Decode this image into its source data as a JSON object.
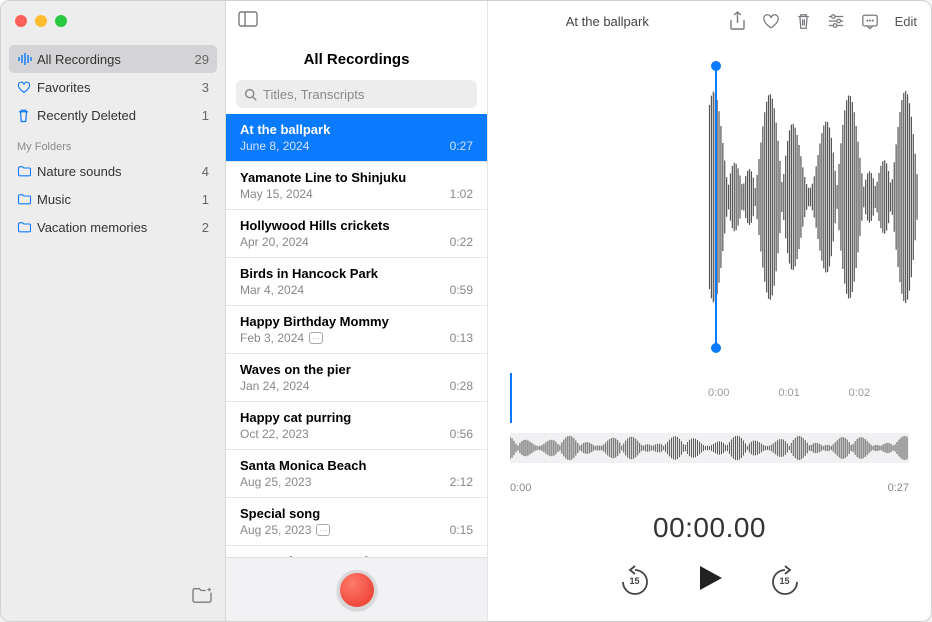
{
  "toolbar": {
    "current_title": "At the ballpark",
    "edit_label": "Edit"
  },
  "sidebar": {
    "smart_items": [
      {
        "label": "All Recordings",
        "count": 29
      },
      {
        "label": "Favorites",
        "count": 3
      },
      {
        "label": "Recently Deleted",
        "count": 1
      }
    ],
    "folders_header": "My Folders",
    "folders": [
      {
        "label": "Nature sounds",
        "count": 4
      },
      {
        "label": "Music",
        "count": 1
      },
      {
        "label": "Vacation memories",
        "count": 2
      }
    ]
  },
  "recordings_column": {
    "title": "All Recordings",
    "search_placeholder": "Titles, Transcripts"
  },
  "recordings": [
    {
      "title": "At the ballpark",
      "date": "June 8, 2024",
      "duration": "0:27",
      "transcript": false
    },
    {
      "title": "Yamanote Line to Shinjuku",
      "date": "May 15, 2024",
      "duration": "1:02",
      "transcript": false
    },
    {
      "title": "Hollywood Hills crickets",
      "date": "Apr 20, 2024",
      "duration": "0:22",
      "transcript": false
    },
    {
      "title": "Birds in Hancock Park",
      "date": "Mar 4, 2024",
      "duration": "0:59",
      "transcript": false
    },
    {
      "title": "Happy Birthday Mommy",
      "date": "Feb 3, 2024",
      "duration": "0:13",
      "transcript": true
    },
    {
      "title": "Waves on the pier",
      "date": "Jan 24, 2024",
      "duration": "0:28",
      "transcript": false
    },
    {
      "title": "Happy cat purring",
      "date": "Oct 22, 2023",
      "duration": "0:56",
      "transcript": false
    },
    {
      "title": "Santa Monica Beach",
      "date": "Aug 25, 2023",
      "duration": "2:12",
      "transcript": false
    },
    {
      "title": "Special song",
      "date": "Aug 25, 2023",
      "duration": "0:15",
      "transcript": true
    },
    {
      "title": "Parrots in Buenos Aires",
      "date": "",
      "duration": "",
      "transcript": false
    }
  ],
  "overview_ticks": [
    "0:00",
    "0:01",
    "0:02"
  ],
  "scrub": {
    "start": "0:00",
    "end": "0:27"
  },
  "timer": "00:00.00",
  "skip_amount": "15"
}
